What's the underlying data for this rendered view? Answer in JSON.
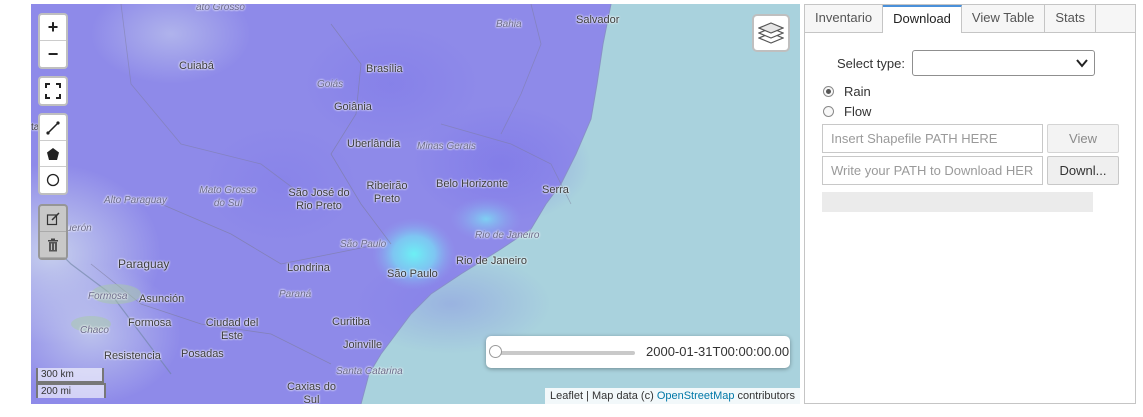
{
  "map": {
    "zoom_in": "+",
    "zoom_out": "−",
    "places": {
      "ato_grosso": "ato Grosso",
      "bahia": "Bahia",
      "salvador": "Salvador",
      "cuiaba": "Cuiabá",
      "brasilia": "Brasília",
      "goias": "Goiás",
      "goiania": "Goiânia",
      "uberlandia": "Uberlândia",
      "minas_gerais": "Minas Gerais",
      "belo_horizonte": "Belo Horizonte",
      "serra": "Serra",
      "mato_grosso_do_sul": "Mato Grosso do Sul",
      "sao_jose_rio_preto": "São José do Rio Preto",
      "ribeirao_preto": "Ribeirão Preto",
      "alto_paraguay": "Alto Paraguay",
      "aqueron": "aquerón",
      "sao_paulo_state": "São Paulo",
      "rio_de_janeiro_state": "Rio de Janeiro",
      "rio_de_janeiro": "Rio de Janeiro",
      "sao_paulo": "São Paulo",
      "paraguay": "Paraguay",
      "londrina": "Londrina",
      "formosa_region": "Formosa",
      "asuncion": "Asunción",
      "parana": "Paraná",
      "chaco": "Chaco",
      "formosa": "Formosa",
      "ciudad_del_este": "Ciudad del Este",
      "curitiba": "Curitiba",
      "joinville": "Joinville",
      "resistencia": "Resistencia",
      "posadas": "Posadas",
      "santa_catarina": "Santa Catarina",
      "caxias_do_sul": "Caxias do Sul",
      "left_edge": "ta"
    },
    "time_label": "2000-01-31T00:00:00.00",
    "scale_km": "300 km",
    "scale_mi": "200 mi",
    "attribution_prefix": "Leaflet | Map data (c) ",
    "attribution_link": "OpenStreetMap",
    "attribution_suffix": " contributors",
    "time_slider_value": 0
  },
  "panel": {
    "tabs": [
      "Inventario",
      "Download",
      "View Table",
      "Stats"
    ],
    "active_tab": "Download",
    "select_label": "Select type:",
    "select_value": "",
    "radio_options": [
      "Rain",
      "Flow"
    ],
    "radio_selected": "Rain",
    "shapefile_placeholder": "Insert Shapefile PATH HERE",
    "view_button": "View",
    "download_placeholder": "Write your PATH to Download HER",
    "download_button": "Downl...",
    "progress": 0
  },
  "colors": {
    "active_tab_accent": "#4a90d9",
    "heat_overlay": "#8a86ee",
    "heat_hotspot": "#66e6f2",
    "ocean": "#a9d2dd",
    "link": "#0078a8"
  }
}
